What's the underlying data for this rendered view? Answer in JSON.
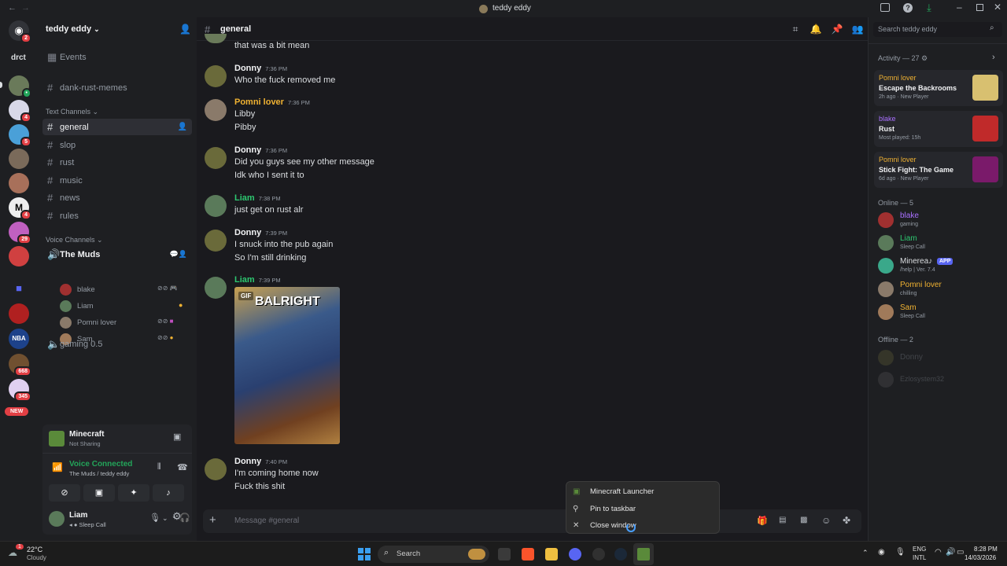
{
  "window": {
    "title": "teddy eddy"
  },
  "server": {
    "name": "teddy eddy"
  },
  "guilds": {
    "dm_badge": "2",
    "drct_label": "drct",
    "badges": [
      "4",
      "5",
      "4",
      "29",
      "668",
      "345"
    ],
    "new_label": "NEW",
    "nba_label": "NBA"
  },
  "channels": {
    "events": "Events",
    "dank": "dank-rust-memes",
    "text_header": "Text Channels",
    "text": [
      "general",
      "slop",
      "rust",
      "music",
      "news",
      "rules"
    ],
    "voice_header": "Voice Channels",
    "voice_channel": "The Muds",
    "voice_users": [
      "blake",
      "Liam",
      "Pomni lover",
      "Sam"
    ],
    "gaming": "gaming 0.5"
  },
  "activity_panel": {
    "game": "Minecraft",
    "sub": "Not Sharing"
  },
  "voice_panel": {
    "status": "Voice Connected",
    "location": "The Muds / teddy eddy"
  },
  "user_panel": {
    "name": "Liam",
    "status": "Sleep Call"
  },
  "chat": {
    "channel": "general",
    "input_placeholder": "Message #general",
    "messages": [
      {
        "name": "",
        "time": "",
        "lines": [
          "that was a bit mean"
        ]
      },
      {
        "name": "Donny",
        "time": "7:36 PM",
        "lines": [
          "Who the fuck removed me"
        ]
      },
      {
        "name": "Pomni lover",
        "time": "7:36 PM",
        "lines": [
          "Libby",
          "Pibby"
        ]
      },
      {
        "name": "Donny",
        "time": "7:36 PM",
        "lines": [
          "Did you guys see my other message",
          "Idk who I sent it to"
        ]
      },
      {
        "name": "Liam",
        "time": "7:38 PM",
        "lines": [
          "just get on rust alr"
        ]
      },
      {
        "name": "Donny",
        "time": "7:39 PM",
        "lines": [
          "I snuck into the pub again",
          "So I'm still drinking"
        ]
      },
      {
        "name": "Liam",
        "time": "7:39 PM",
        "lines": []
      },
      {
        "name": "Donny",
        "time": "7:40 PM",
        "lines": [
          "I'm coming home now",
          "Fuck this shit"
        ]
      }
    ],
    "gif": {
      "badge": "GIF",
      "caption": "BALRIGHT"
    }
  },
  "members": {
    "search_placeholder": "Search teddy eddy",
    "activity_header": "Activity — 27",
    "activities": [
      {
        "name": "Pomni lover",
        "title": "Escape the Backrooms",
        "sub": "2h ago · New Player"
      },
      {
        "name": "blake",
        "title": "Rust",
        "sub": "Most played: 15h"
      },
      {
        "name": "Pomni lover",
        "title": "Stick Fight: The Game",
        "sub": "6d ago · New Player"
      }
    ],
    "online_header": "Online — 5",
    "online": [
      {
        "name": "blake",
        "status": "gaming"
      },
      {
        "name": "Liam",
        "status": "Sleep Call"
      },
      {
        "name": "Minerea♪",
        "status": "/help | Ver. 7.4",
        "tag": "APP"
      },
      {
        "name": "Pomni lover",
        "status": "chilling"
      },
      {
        "name": "Sam",
        "status": "Sleep Call"
      }
    ],
    "offline_header": "Offline — 2",
    "offline": [
      "Donny",
      "Ezlosystem32"
    ]
  },
  "context_menu": {
    "items": [
      "Minecraft Launcher",
      "Pin to taskbar",
      "Close window"
    ]
  },
  "taskbar": {
    "weather_temp": "22°C",
    "weather_desc": "Cloudy",
    "weather_badge": "1",
    "search": "Search",
    "lang": "ENG",
    "lang2": "INTL",
    "time": "8:28 PM",
    "date": "14/03/2026"
  },
  "colors": {
    "accent": "#5865f2",
    "online": "#23a55a",
    "liam": "#2dc770",
    "pomni": "#f0b232",
    "blake": "#a970ff"
  }
}
